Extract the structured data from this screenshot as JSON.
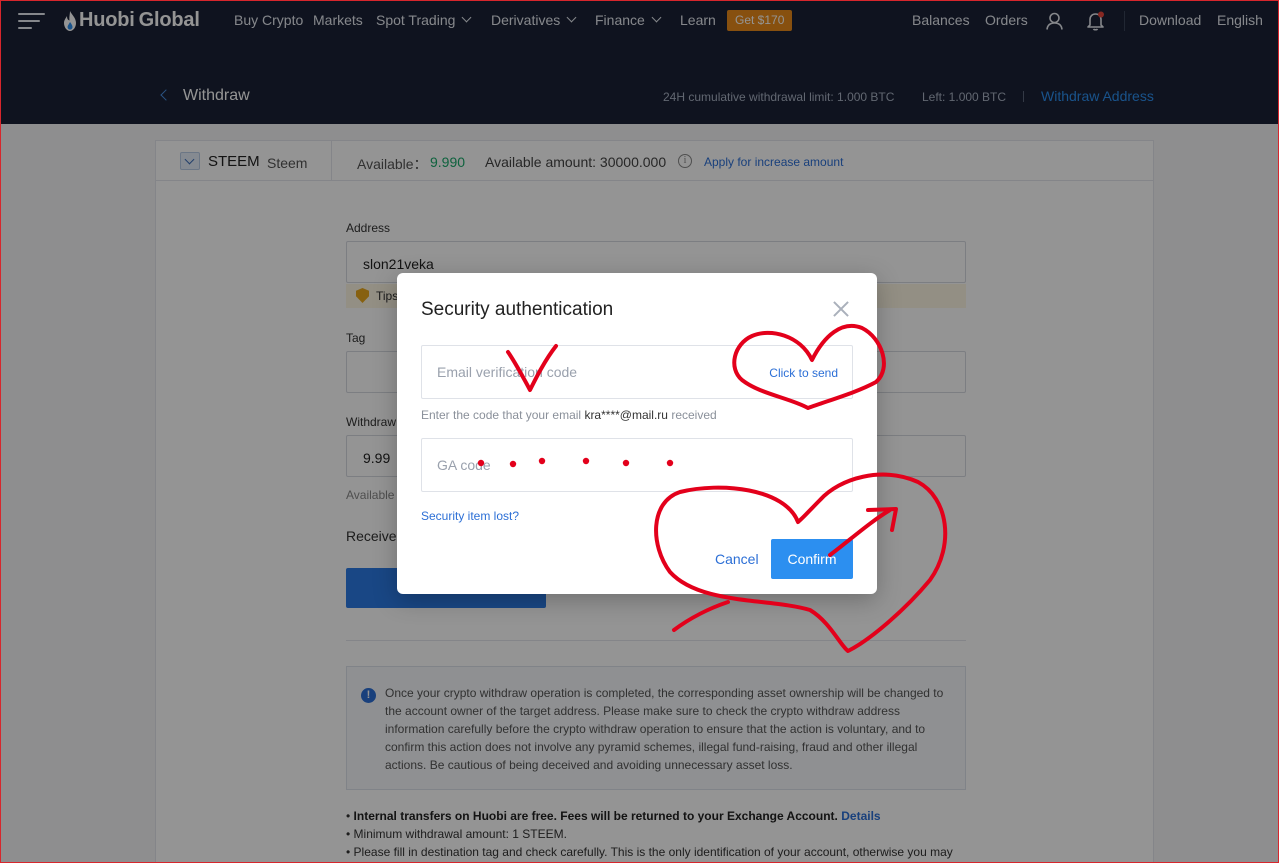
{
  "topnav": {
    "brand_a": "Huobi",
    "brand_b": "Global",
    "items": [
      "Buy Crypto",
      "Markets",
      "Spot Trading",
      "Derivatives",
      "Finance",
      "Learn"
    ],
    "promo": "Get $170",
    "right": [
      "Balances",
      "Orders",
      "Download",
      "English"
    ]
  },
  "header": {
    "title": "Withdraw",
    "limit": "24H cumulative withdrawal limit: 1.000 BTC",
    "left": "Left: 1.000 BTC",
    "withdraw_address": "Withdraw Address"
  },
  "coin": {
    "symbol": "STEEM",
    "name": "Steem",
    "available_label": "Available：",
    "available_value": "9.990",
    "available_amount": "Available amount: 30000.000",
    "apply": "Apply for increase amount"
  },
  "form": {
    "address_label": "Address",
    "address_value": "slon21veka",
    "tips": "Tips",
    "tag_label": "Tag",
    "withdraw_label": "Withdraw",
    "withdraw_value": "9.99",
    "available_small": "Available",
    "receive_label": "Receive"
  },
  "notice": "Once your crypto withdraw operation is completed, the corresponding asset ownership will be changed to the account owner of the target address. Please make sure to check the crypto withdraw address information carefully before the crypto withdraw operation to ensure that the action is voluntary, and to confirm this action does not involve any pyramid schemes, illegal fund-raising, fraud and other illegal actions. Be cautious of being deceived and avoiding unnecessary asset loss.",
  "rules": {
    "r1": "Internal transfers on Huobi are free. Fees will be returned to your Exchange Account.",
    "r1_link": "Details",
    "r2": "Minimum withdrawal amount: 1 STEEM.",
    "r3": "Please fill in destination tag and check carefully. This is the only identification of your account, otherwise you may"
  },
  "modal": {
    "title": "Security authentication",
    "email_placeholder": "Email verification code",
    "send": "Click to send",
    "hint_prefix": "Enter the code that your email",
    "hint_email": "kra****@mail.ru",
    "hint_suffix": "received",
    "ga_placeholder": "GA code",
    "lost": "Security item lost?",
    "cancel": "Cancel",
    "confirm": "Confirm"
  },
  "colors": {
    "nav_bg": "#1a2236",
    "accent": "#2c8ff0",
    "promo": "#e88b1a",
    "available_green": "#1aaa6b",
    "annotation_red": "#e3001b"
  }
}
